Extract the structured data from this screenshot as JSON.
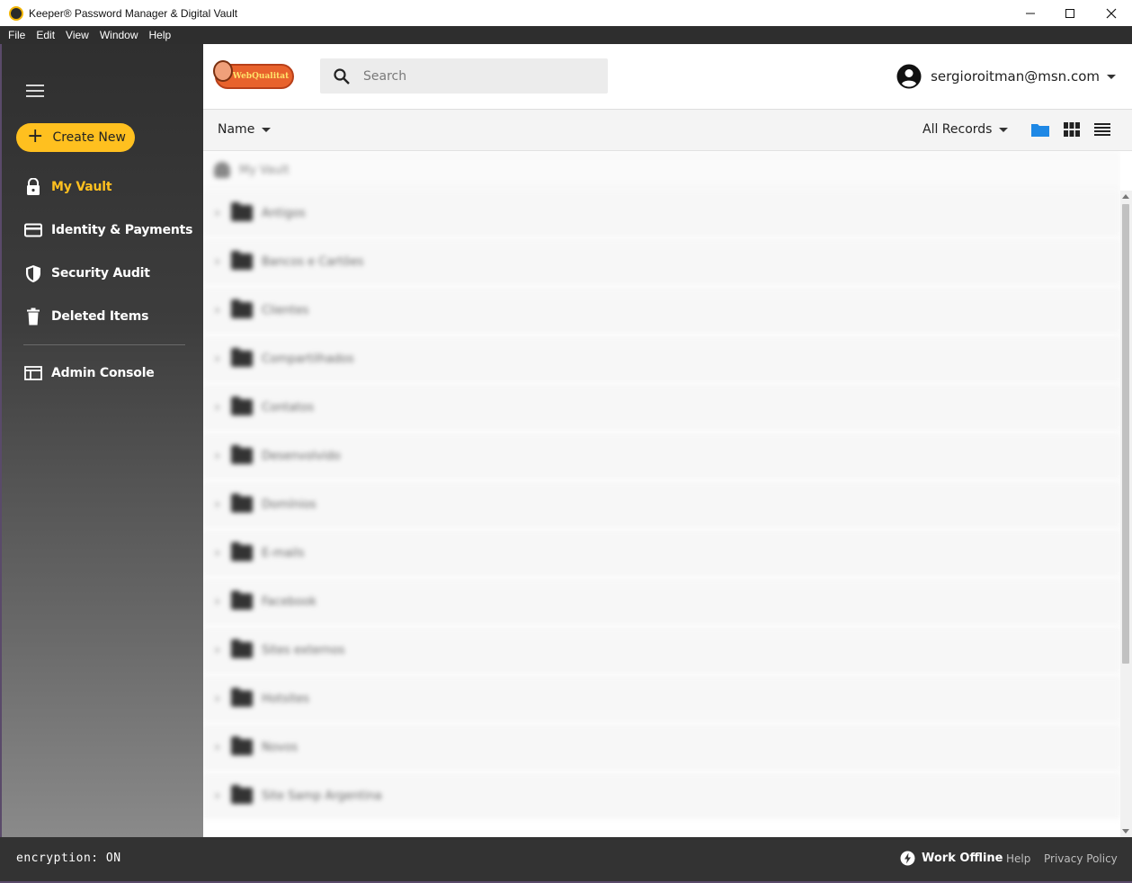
{
  "window": {
    "title": "Keeper® Password Manager & Digital Vault",
    "controls": {
      "minimize": "—",
      "maximize": "☐",
      "close": "✕"
    }
  },
  "menubar": {
    "items": [
      "File",
      "Edit",
      "View",
      "Window",
      "Help"
    ]
  },
  "sidebar": {
    "create_label": "Create New",
    "items": [
      {
        "label": "My Vault",
        "icon": "lock-icon",
        "active": true
      },
      {
        "label": "Identity & Payments",
        "icon": "credit-card-icon",
        "active": false
      },
      {
        "label": "Security Audit",
        "icon": "shield-icon",
        "active": false
      },
      {
        "label": "Deleted Items",
        "icon": "trash-icon",
        "active": false
      },
      {
        "label": "Admin Console",
        "icon": "console-icon",
        "active": false
      }
    ]
  },
  "header": {
    "logo_text": "WebQualitat",
    "search": {
      "placeholder": "Search",
      "value": ""
    },
    "account_email": "sergioroitman@msn.com"
  },
  "toolbar": {
    "sort_label": "Name",
    "filter_label": "All Records",
    "view_modes": [
      "folder-view",
      "grid-view",
      "list-view"
    ],
    "active_view": "folder-view",
    "accent": "#1e88e5"
  },
  "vault": {
    "root_label": "My Vault",
    "folders": [
      "Antigos",
      "Bancos e Cartões",
      "Clientes",
      "Compartilhados",
      "Contatos",
      "Desenvolvido",
      "Domínios",
      "E-mails",
      "Facebook",
      "Sites externos",
      "Hotsites",
      "Novos",
      "Site Samp Argentina"
    ]
  },
  "footer": {
    "encryption": "encryption: ON",
    "work_offline": "Work Offline",
    "help": "Help",
    "privacy": "Privacy Policy"
  },
  "colors": {
    "brand_yellow": "#ffc01f",
    "sidebar_dark": "#2f2f2f",
    "footer_bg": "#333333"
  }
}
